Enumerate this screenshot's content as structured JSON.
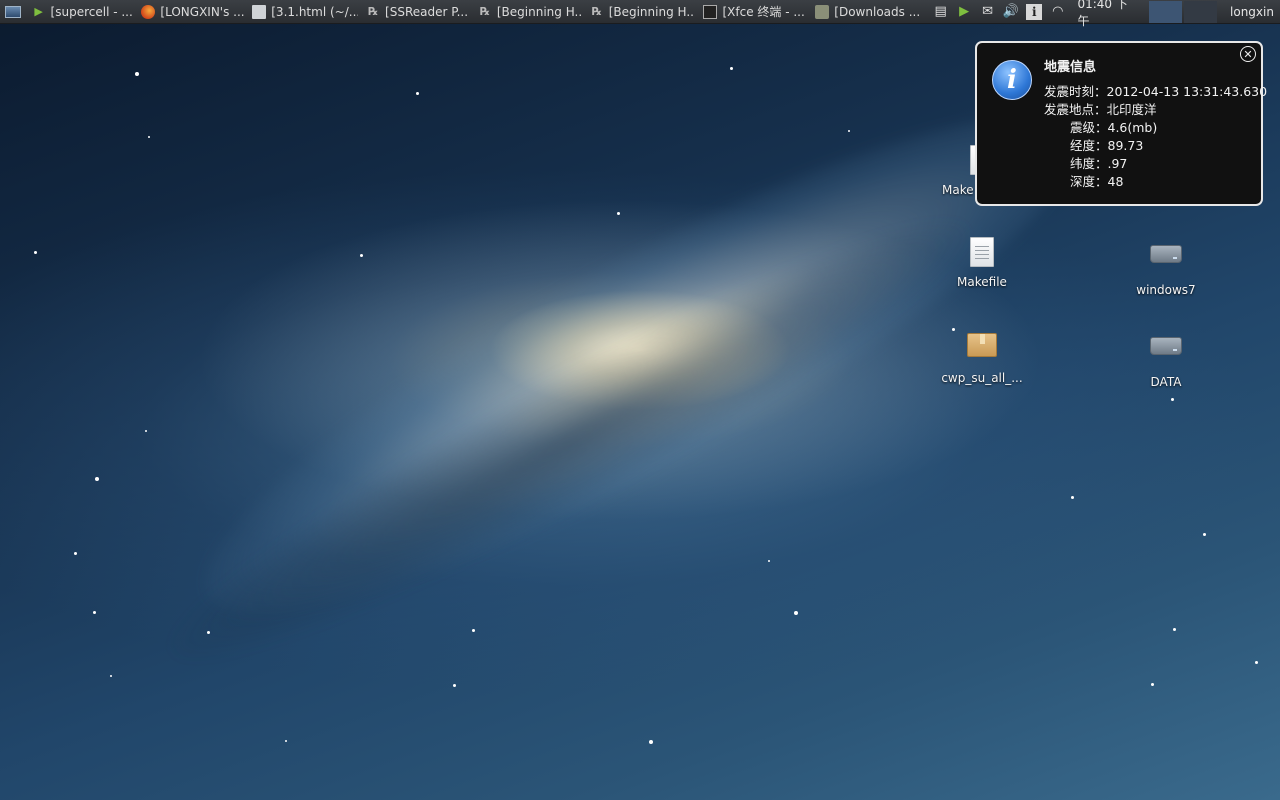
{
  "taskbar": {
    "tasks": [
      {
        "label": "[supercell - ...",
        "icon": "terminal-icon"
      },
      {
        "label": "[LONGXIN's ...",
        "icon": "firefox-icon"
      },
      {
        "label": "[3.1.html (~/...",
        "icon": "text-editor-icon"
      },
      {
        "label": "[SSReader P...",
        "icon": "ssreader-icon"
      },
      {
        "label": "[Beginning H...",
        "icon": "ssreader-icon"
      },
      {
        "label": "[Beginning H...",
        "icon": "ssreader-icon"
      },
      {
        "label": "[Xfce 终端 - ...",
        "icon": "xfce-terminal-icon"
      },
      {
        "label": "[Downloads ...",
        "icon": "folder-icon"
      }
    ],
    "clock": "01:40 下午",
    "user": "longxin"
  },
  "notification": {
    "title": "地震信息",
    "lines": [
      "发震时刻：2012-04-13 13:31:43.630",
      "发震地点：北印度洋",
      "震级：4.6(mb)",
      "经度：89.73",
      "纬度：.97",
      "深度：48"
    ]
  },
  "desktop_icons": [
    {
      "label": "Make",
      "type": "file"
    },
    {
      "label": "Makefile",
      "type": "file"
    },
    {
      "label": "windows7",
      "type": "drive"
    },
    {
      "label": "cwp_su_all_...",
      "type": "archive"
    },
    {
      "label": "DATA",
      "type": "drive"
    }
  ]
}
